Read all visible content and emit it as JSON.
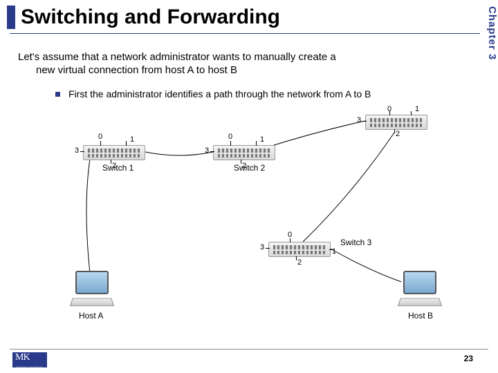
{
  "chapter_label": "Chapter 3",
  "title": "Switching and Forwarding",
  "paragraph_line1": "Let's assume that a network administrator wants to manually create a",
  "paragraph_line2": "new virtual connection from host A to host B",
  "bullet1": "First the administrator identifies a path through the network from A to B",
  "diagram": {
    "switch1": {
      "label": "Switch 1",
      "ports": {
        "left": "3",
        "top_left": "0",
        "top_right": "1",
        "bottom": "2"
      }
    },
    "switch2": {
      "label": "Switch 2",
      "ports": {
        "left": "3",
        "top_left": "0",
        "top_right": "1",
        "bottom": "2"
      }
    },
    "switch3_top": {
      "label": "",
      "ports": {
        "left": "3",
        "top_left": "0",
        "top_right": "1",
        "bottom": "2"
      }
    },
    "switch3": {
      "label": "Switch 3",
      "ports": {
        "left": "3",
        "top_left": "0",
        "right": "1",
        "bottom": "2"
      }
    },
    "hostA": {
      "label": "Host A"
    },
    "hostB": {
      "label": "Host B"
    }
  },
  "logo": {
    "mk": "MK",
    "sub": "MORGAN KAUFMANN"
  },
  "page": "23"
}
